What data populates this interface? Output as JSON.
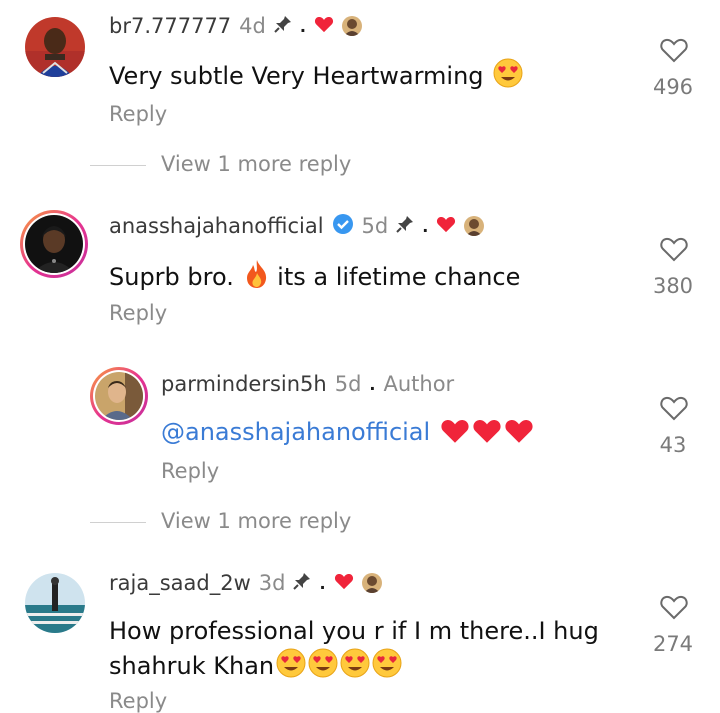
{
  "comments": [
    {
      "username": "br7.777777",
      "time": "4d",
      "text": "Very subtle Very Heartwarming",
      "reply_label": "Reply",
      "likes": "496",
      "view_more": "View 1 more reply",
      "liked_by_creator": true,
      "pinned_icon": "pin-icon"
    },
    {
      "username": "anasshajahanofficial",
      "verified": true,
      "time": "5d",
      "text_a": "Suprb bro.",
      "text_b": "its a lifetime chance",
      "reply_label": "Reply",
      "likes": "380",
      "liked_by_creator": true
    },
    {
      "username": "raja_saad_2w",
      "time": "3d",
      "text_line1": "How professional you r if I m there..I hug",
      "text_line2": "shahruk Khan",
      "reply_label": "Reply",
      "likes": "274",
      "liked_by_creator": true
    }
  ],
  "reply": {
    "username": "parmindersin5h",
    "time": "5d",
    "author_badge": "Author",
    "mention": "@anasshajahanofficial",
    "reply_label": "Reply",
    "likes": "43",
    "view_more": "View 1 more reply"
  },
  "colors": {
    "heart_red": "#f0243a",
    "mention_blue": "#3a7bd5",
    "meta_gray": "#8a8a8a"
  }
}
